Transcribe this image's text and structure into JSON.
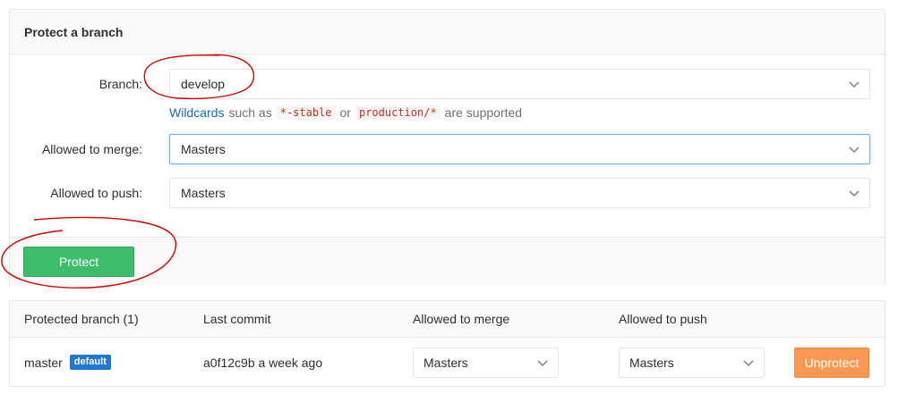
{
  "protect_panel": {
    "title": "Protect a branch",
    "branch": {
      "label": "Branch:",
      "value": "develop"
    },
    "help": {
      "link": "Wildcards",
      "text_1": "such as",
      "code_1": "*-stable",
      "text_2": "or",
      "code_2": "production/*",
      "text_3": "are supported"
    },
    "merge": {
      "label": "Allowed to merge:",
      "value": "Masters"
    },
    "push": {
      "label": "Allowed to push:",
      "value": "Masters"
    },
    "protect_button": "Protect"
  },
  "protected_table": {
    "headers": {
      "branch": "Protected branch (1)",
      "commit": "Last commit",
      "merge": "Allowed to merge",
      "push": "Allowed to push"
    },
    "rows": [
      {
        "branch": "master",
        "badge": "default",
        "commit": "a0f12c9b a week ago",
        "merge": "Masters",
        "push": "Masters",
        "unprotect": "Unprotect"
      }
    ]
  },
  "colors": {
    "protect_button": "#3cbd6a",
    "unprotect_button": "#fc9852",
    "default_badge": "#1f78d1",
    "annotation": "#d40000"
  }
}
